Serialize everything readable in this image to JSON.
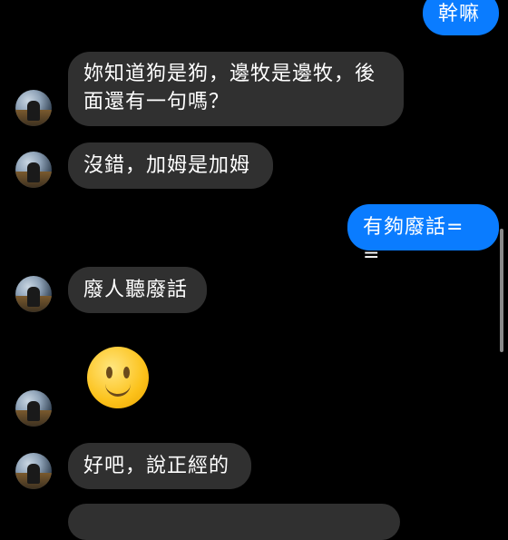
{
  "messages": [
    {
      "dir": "out",
      "text": "幹嘛"
    },
    {
      "dir": "in",
      "lines": [
        "妳知道狗是狗，邊牧是邊牧，後",
        "面還有一句嗎？"
      ]
    },
    {
      "dir": "in",
      "text": "沒錯，加姆是加姆"
    },
    {
      "dir": "out",
      "text": "有夠廢話= ="
    },
    {
      "dir": "in",
      "text": "廢人聽廢話"
    },
    {
      "dir": "in",
      "emoji": "slightly-smiling-face"
    },
    {
      "dir": "in",
      "text": "好吧，說正經的"
    }
  ],
  "avatar_icon": "user-avatar-photo",
  "colors": {
    "outgoing": "#0a7cff",
    "incoming": "#303030",
    "background": "#000000"
  }
}
